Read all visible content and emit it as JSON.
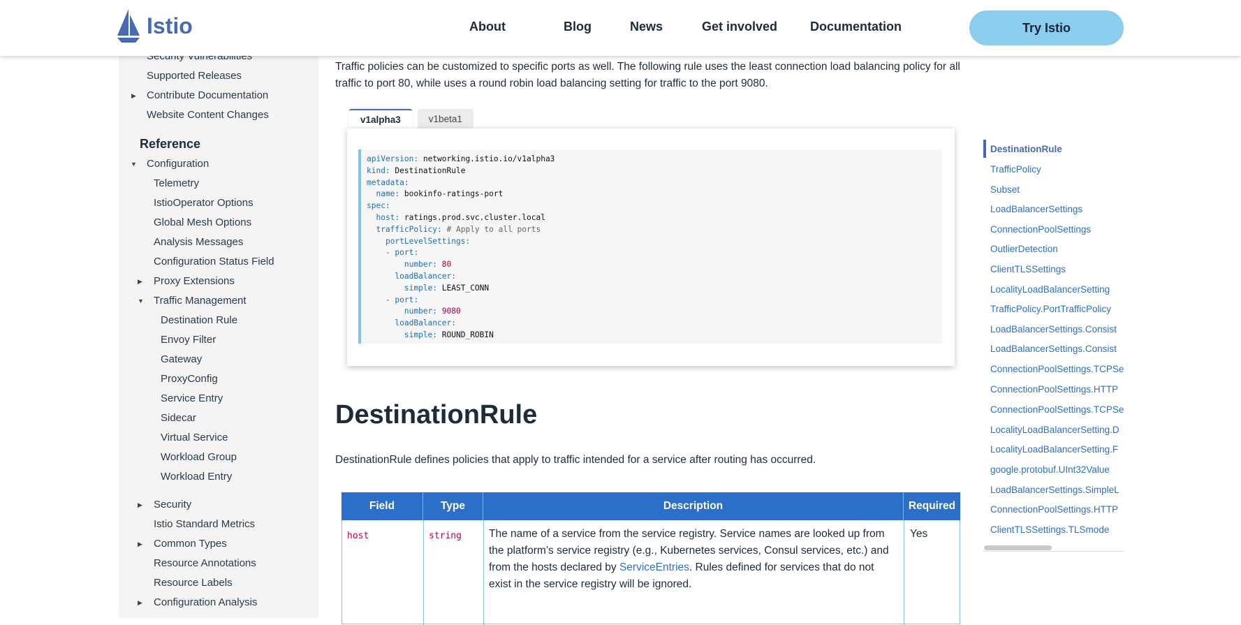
{
  "header": {
    "logo_text": "Istio",
    "nav": [
      "About",
      "Blog",
      "News",
      "Get involved",
      "Documentation"
    ],
    "try_label": "Try Istio"
  },
  "sidebar": {
    "items_top": [
      "Security Vulnerabilities",
      "Supported Releases",
      "Contribute Documentation",
      "Website Content Changes"
    ],
    "reference_heading": "Reference",
    "configuration": "Configuration",
    "config_items": [
      "Telemetry",
      "IstioOperator Options",
      "Global Mesh Options",
      "Analysis Messages",
      "Configuration Status Field",
      "Proxy Extensions",
      "Traffic Management"
    ],
    "traffic_items": [
      "Destination Rule",
      "Envoy Filter",
      "Gateway",
      "ProxyConfig",
      "Service Entry",
      "Sidecar",
      "Virtual Service",
      "Workload Group",
      "Workload Entry"
    ],
    "items_bottom": [
      "Security",
      "Istio Standard Metrics",
      "Common Types",
      "Resource Annotations",
      "Resource Labels",
      "Configuration Analysis"
    ]
  },
  "main": {
    "intro": "Traffic policies can be customized to specific ports as well. The following rule uses the least connection load balancing policy for all traffic to port 80, while uses a round robin load balancing setting for traffic to the port 9080.",
    "tabs": [
      "v1alpha3",
      "v1beta1"
    ],
    "code": {
      "api_key": "apiVersion:",
      "api_val": " networking.istio.io/v1alpha3",
      "kind_key": "kind:",
      "kind_val": " DestinationRule",
      "meta_key": "metadata:",
      "name_key": "  name:",
      "name_val": " bookinfo-ratings-port",
      "spec_key": "spec:",
      "host_key": "  host:",
      "host_val": " ratings.prod.svc.cluster.local",
      "tp_key": "  trafficPolicy:",
      "tp_comment": " # Apply to all ports",
      "pls_key": "    portLevelSettings:",
      "port_key": "    - port:",
      "number_key": "        number:",
      "num1": " 80",
      "num2": " 9080",
      "lb_key": "      loadBalancer:",
      "simple_key": "        simple:",
      "simple1": " LEAST_CONN",
      "simple2": " ROUND_ROBIN"
    },
    "heading": "DestinationRule",
    "description": "DestinationRule defines policies that apply to traffic intended for a service after routing has occurred.",
    "table": {
      "headers": [
        "Field",
        "Type",
        "Description",
        "Required"
      ],
      "row_field": "host",
      "row_type": "string",
      "row_desc_a": "The name of a service from the service registry. Service names are looked up from the platform’s service registry (e.g., Kubernetes services, Consul services, etc.) and from the hosts declared by ",
      "row_desc_link": "ServiceEntries",
      "row_desc_b": ". Rules defined for services that do not exist in the service registry will be ignored.",
      "row_required": "Yes"
    }
  },
  "toc": {
    "items": [
      "DestinationRule",
      "TrafficPolicy",
      "Subset",
      "LoadBalancerSettings",
      "ConnectionPoolSettings",
      "OutlierDetection",
      "ClientTLSSettings",
      "LocalityLoadBalancerSetting",
      "TrafficPolicy.PortTrafficPolicy",
      "LoadBalancerSettings.Consist",
      "LoadBalancerSettings.Consist",
      "ConnectionPoolSettings.TCPSe",
      "ConnectionPoolSettings.HTTP",
      "ConnectionPoolSettings.TCPSe",
      "LocalityLoadBalancerSetting.D",
      "LocalityLoadBalancerSetting.F",
      "google.protobuf.UInt32Value",
      "LoadBalancerSettings.SimpleL",
      "ConnectionPoolSettings.HTTP",
      "ClientTLSSettings.TLSmode"
    ]
  }
}
